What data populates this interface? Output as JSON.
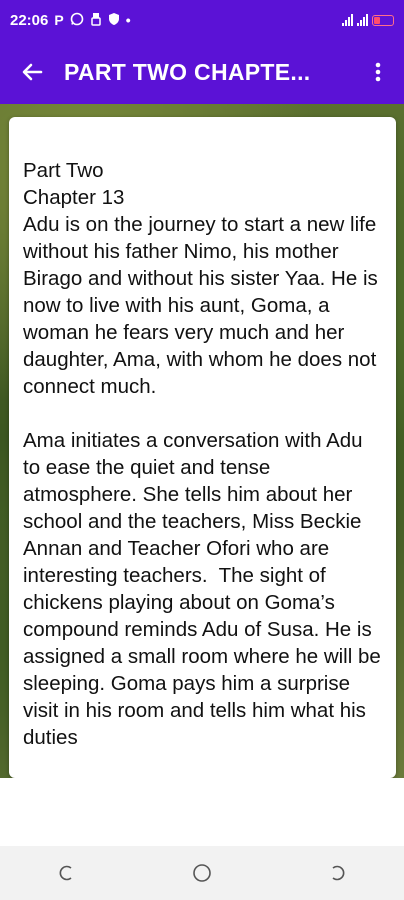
{
  "status_bar": {
    "time": "22:06",
    "icons": [
      "p-icon",
      "whatsapp-icon",
      "usb-debug-icon",
      "shield-icon",
      "dot-icon"
    ],
    "battery_color": "#ff4d6d"
  },
  "app_bar": {
    "title": "PART TWO CHAPTE...",
    "back_icon": "arrow-left-icon",
    "menu_icon": "more-vertical-icon",
    "color": "#5b12d6"
  },
  "content": {
    "text": "Part Two\nChapter 13\nAdu is on the journey to start a new life without his father Nimo, his mother Birago and without his sister Yaa. He is now to live with his aunt, Goma, a woman he fears very much and her daughter, Ama, with whom he does not connect much.\n\nAma initiates a conversation with Adu to ease the quiet and tense atmosphere. She tells him about her school and the teachers, Miss Beckie Annan and Teacher Ofori who are interesting teachers.  The sight of chickens playing about on Goma’s compound reminds Adu of Susa. He is assigned a small room where he will be sleeping. Goma pays him a surprise visit in his room and tells him what his duties"
  },
  "nav_bar": {
    "recent_icon": "recent-apps-icon",
    "home_icon": "home-circle-icon",
    "back_icon": "back-icon"
  }
}
